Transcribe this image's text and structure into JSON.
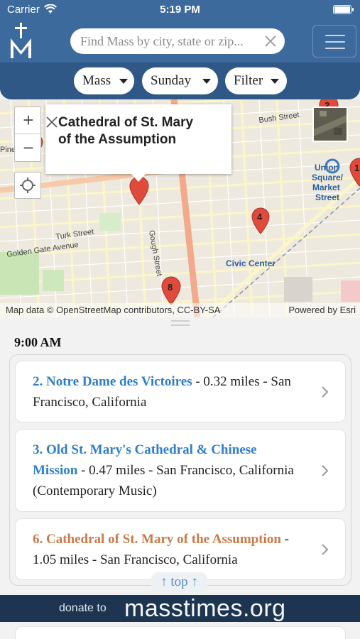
{
  "status_bar": {
    "carrier": "Carrier",
    "time": "5:19 PM"
  },
  "header": {
    "search_placeholder": "Find Mass by city, state or zip...",
    "filters": [
      {
        "label": "Mass"
      },
      {
        "label": "Sunday"
      },
      {
        "label": "Filter"
      }
    ]
  },
  "map": {
    "popup_title": "Cathedral of St. Mary of the Assumption",
    "zoom_in": "+",
    "zoom_out": "−",
    "attribution": "Map data © OpenStreetMap contributors, CC-BY-SA",
    "powered_by": "Powered by Esri",
    "markers": [
      "2",
      "4",
      "8",
      "1"
    ],
    "labels": {
      "turk_street": "Turk Street",
      "golden_gate": "Golden Gate Avenue",
      "gough_street": "Gough Street",
      "bush_street": "Bush Street",
      "civic_center": "Civic Center",
      "union_square_1": "Union",
      "union_square_2": "Square/",
      "union_square_3": "Market",
      "union_square_4": "Street",
      "pine": "Pine"
    }
  },
  "list": {
    "time_heading": "9:00 AM",
    "items": [
      {
        "name": "2. Notre Dame des Victoires",
        "detail": " - 0.32 miles - San Francisco, California",
        "current": false
      },
      {
        "name": "3. Old St. Mary's Cathedral & Chinese Mission",
        "detail": " - 0.47 miles - San Francisco, California (Contemporary Music)",
        "current": false
      },
      {
        "name": "6. Cathedral of St. Mary of the Assumption",
        "detail": " - 1.05 miles - San Francisco, California",
        "current": true
      }
    ],
    "top_button": "↑ top ↑"
  },
  "donate_banner": {
    "small": "donate to",
    "big": "masstimes.org"
  },
  "colors": {
    "header": "#3d6a9d",
    "link": "#2e7ec9",
    "current": "#c97a48",
    "marker": "#e04a3c"
  }
}
